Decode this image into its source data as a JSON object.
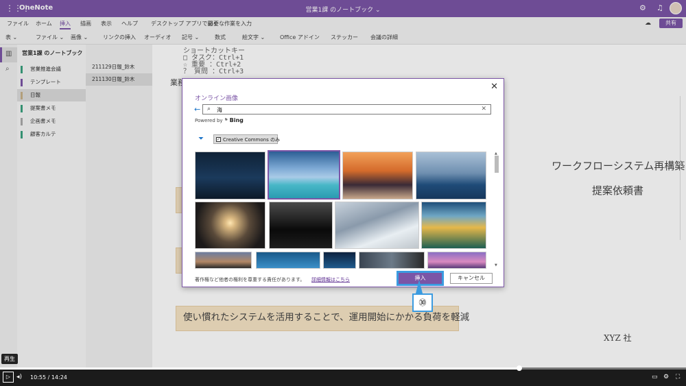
{
  "app": {
    "name": "OneNote",
    "notebook_title": "営業1課 のノートブック ⌄"
  },
  "menu": [
    "ファイル",
    "ホーム",
    "挿入",
    "描画",
    "表示",
    "ヘルプ",
    "デスクトップ アプリで開く",
    "必要な作業を入力"
  ],
  "share_label": "共有",
  "ribbon": [
    "表 ⌄",
    "ファイル ⌄",
    "画像 ⌄",
    "リンクの挿入",
    "オーディオ",
    "記号 ⌄",
    "数式",
    "絵文字 ⌄",
    "Office アドイン",
    "ステッカー",
    "会議の詳細"
  ],
  "sidebar": {
    "notebook": "営業1課 のノートブック",
    "sections": [
      {
        "label": "営業推進会議",
        "color": "#3aa17e"
      },
      {
        "label": "テンプレート",
        "color": "#7b55a6"
      },
      {
        "label": "日報",
        "color": "#c8b28a"
      },
      {
        "label": "提案書メモ",
        "color": "#3aa17e"
      },
      {
        "label": "企画書メモ",
        "color": "#aaaaaa"
      },
      {
        "label": "顧客カルテ",
        "color": "#3aa17e"
      }
    ]
  },
  "pages": [
    "211129日報_鈴木",
    "211130日報_鈴木"
  ],
  "canvas": {
    "shortcut_heading": "ショートカットキー",
    "shortcuts": [
      "□ タスク：Ctrl+1",
      "☆ 重要 ：Ctrl+2",
      "？ 質問 ：Ctrl+3"
    ],
    "partial_label": "業務",
    "title1": "ワークフローシステム再構築",
    "title2": "提案依頼書",
    "banner": "使い慣れたシステムを活用することで、運用開始にかかる負荷を軽減",
    "company": "XYZ 社"
  },
  "dialog": {
    "title": "オンライン画像",
    "search_value": "海",
    "powered_by": "Powered by",
    "bing": "Bing",
    "filter_label": "Creative Commons のみ",
    "notice": "著作権など他者の権利を尊重する責任があります。",
    "notice_link": "詳細情報はこちら",
    "insert": "挿入",
    "cancel": "キャンセル"
  },
  "callout_label": "㉚",
  "video": {
    "tooltip": "再生",
    "current": "10:55",
    "total": "14:24",
    "progress": 0.757
  }
}
